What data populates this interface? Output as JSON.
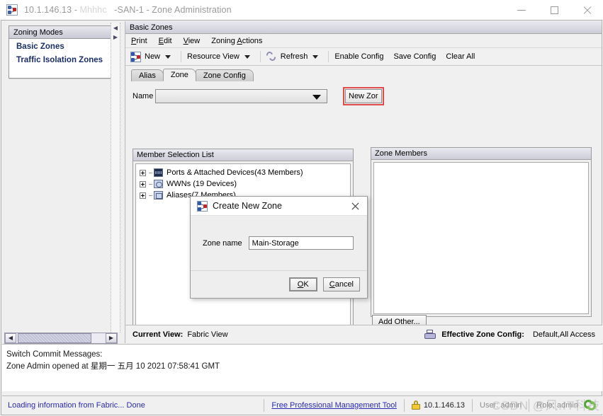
{
  "window": {
    "title_prefix": "10.1.146.13 - ",
    "title_faded": "Mhhhc",
    "title_suffix": "-SAN-1 - Zone Administration",
    "icon": "network-zone-icon",
    "minimize_label": "Minimize",
    "maximize_label": "Maximize",
    "close_label": "Close"
  },
  "sidebar": {
    "header": "Zoning Modes",
    "items": [
      {
        "label": "Basic Zones"
      },
      {
        "label": "Traffic Isolation Zones"
      }
    ]
  },
  "main": {
    "panel_title": "Basic Zones",
    "menu": [
      {
        "label": "Print",
        "mnemonic": "P"
      },
      {
        "label": "Edit",
        "mnemonic": "E"
      },
      {
        "label": "View",
        "mnemonic": "V"
      },
      {
        "label": "Zoning Actions",
        "mnemonic": "A"
      }
    ],
    "toolbar": {
      "new_label": "New",
      "new_icon": "new-zone-icon",
      "resource_view_label": "Resource View",
      "refresh_label": "Refresh",
      "refresh_icon": "refresh-icon",
      "enable_config_label": "Enable Config",
      "save_config_label": "Save Config",
      "clear_all_label": "Clear All"
    },
    "tabs": [
      {
        "label": "Alias",
        "active": false
      },
      {
        "label": "Zone",
        "active": true
      },
      {
        "label": "Zone Config",
        "active": false
      }
    ],
    "name_row": {
      "label": "Name",
      "value": "",
      "placeholder": "",
      "new_zone_button": "New Zor",
      "new_zone_button_full": "New Zone",
      "highlight_color": "#e04b4b"
    },
    "member_selection": {
      "header": "Member Selection List",
      "items": [
        {
          "label": "Ports & Attached Devices(43 Members)",
          "icon": "ports-icon",
          "expander": "plus"
        },
        {
          "label": "WWNs (19 Devices)",
          "icon": "wwn-icon",
          "expander": "plus"
        },
        {
          "label": "Aliases(7 Members)",
          "icon": "alias-icon",
          "expander": "plus"
        }
      ]
    },
    "zone_members": {
      "header": "Zone Members",
      "items": [],
      "add_other_label": "Add Other..."
    },
    "footer": {
      "current_view_label": "Current View:",
      "current_view_value": "Fabric View",
      "printer_icon": "printer-icon",
      "effective_config_label": "Effective Zone Config:",
      "effective_config_value": "Default,All Access"
    }
  },
  "dialog": {
    "icon": "new-zone-icon",
    "title": "Create New Zone",
    "close_label": "Close",
    "field_label": "Zone name",
    "field_value": "Main-Storage",
    "field_placeholder": "",
    "ok_label": "OK",
    "ok_mnemonic": "O",
    "cancel_label": "Cancel",
    "cancel_mnemonic": "C"
  },
  "commit_messages": {
    "heading": "Switch Commit Messages:",
    "lines": [
      "Zone Admin opened at 星期一 五月 10 2021 07:58:41 GMT"
    ]
  },
  "statusbar": {
    "loading_text": "Loading information from Fabric... Done",
    "tool_link": "Free Professional Management Tool",
    "lock_icon": "lock-icon",
    "host": "10.1.146.13",
    "user": "User: admin",
    "role": "Role: admin",
    "refresh_icon": "refresh-green-icon"
  },
  "watermark": {
    "text": "CSDN @风.IT科技"
  }
}
